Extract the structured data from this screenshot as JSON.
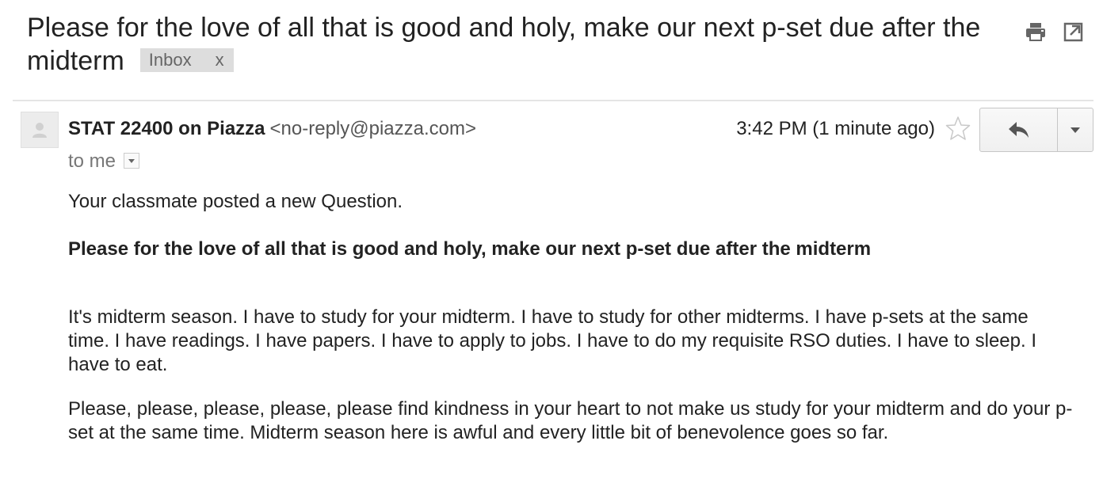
{
  "email": {
    "subject": "Please for the love of all that is good and holy, make our next p-set due after the midterm",
    "label": {
      "text": "Inbox",
      "remove": "x"
    },
    "sender": {
      "name": "STAT 22400 on Piazza",
      "email": "<no-reply@piazza.com>"
    },
    "recipient": "to me",
    "timestamp": "3:42 PM (1 minute ago)",
    "starred": false,
    "body": {
      "intro": "Your classmate posted a new Question.",
      "question_title": "Please for the love of all that is good and holy, make our next p-set due after the midterm",
      "paragraphs": [
        "It's midterm season. I have to study for your midterm. I have to study for other midterms. I have p-sets at the same time. I have readings. I have papers. I have to apply to jobs. I have to do my requisite RSO duties. I have to sleep. I have to eat.",
        "Please, please, please, please, please find kindness in your heart to not make us study for your midterm and do your p-set at the same time. Midterm season here is awful and every little bit of benevolence goes so far."
      ]
    }
  },
  "toolbar": {
    "icons": [
      "print-icon",
      "new-window-icon"
    ]
  },
  "actions": {
    "icons": [
      "star-icon",
      "reply-icon",
      "chevron-down-icon"
    ]
  },
  "colors": {
    "label_bg": "#dddddd",
    "divider": "#e5e5e5",
    "button_border": "#c6c6c6"
  }
}
